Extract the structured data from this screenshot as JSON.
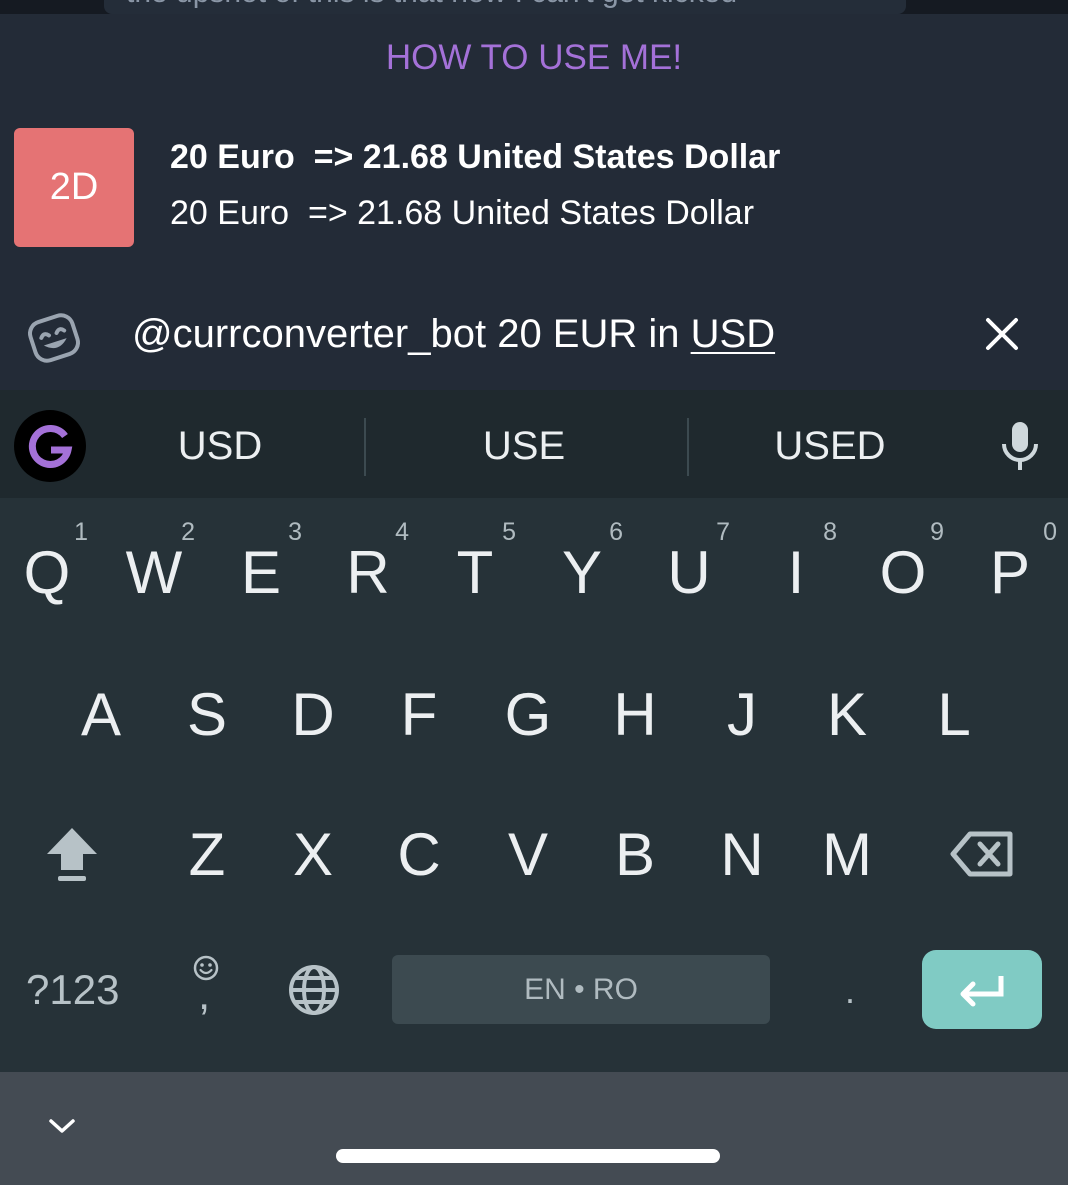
{
  "chat": {
    "previous_message": "the upshot of this is that now I can't get kicked"
  },
  "bot_results": {
    "header": "HOW TO USE ME!",
    "items": [
      {
        "avatar_text": "2D",
        "title": "20 Euro  => 21.68 United States Dollar",
        "description": "20 Euro  => 21.68 United States Dollar"
      }
    ]
  },
  "input": {
    "text_prefix": "@currconverter_bot 20 EUR in ",
    "text_composing": "USD"
  },
  "keyboard": {
    "suggestions": [
      "USD",
      "USE",
      "USED"
    ],
    "row1": [
      {
        "letter": "Q",
        "hint": "1"
      },
      {
        "letter": "W",
        "hint": "2"
      },
      {
        "letter": "E",
        "hint": "3"
      },
      {
        "letter": "R",
        "hint": "4"
      },
      {
        "letter": "T",
        "hint": "5"
      },
      {
        "letter": "Y",
        "hint": "6"
      },
      {
        "letter": "U",
        "hint": "7"
      },
      {
        "letter": "I",
        "hint": "8"
      },
      {
        "letter": "O",
        "hint": "9"
      },
      {
        "letter": "P",
        "hint": "0"
      }
    ],
    "row2": [
      "A",
      "S",
      "D",
      "F",
      "G",
      "H",
      "J",
      "K",
      "L"
    ],
    "row3": [
      "Z",
      "X",
      "C",
      "V",
      "B",
      "N",
      "M"
    ],
    "symbols_label": "?123",
    "comma_label": ",",
    "period_label": ".",
    "space_label": "EN • RO",
    "icons": {
      "logo": "google-g-icon",
      "mic": "microphone-icon",
      "shift": "shift-icon",
      "backspace": "backspace-icon",
      "emoji": "emoji-icon",
      "globe": "globe-icon",
      "enter": "enter-icon"
    }
  },
  "colors": {
    "accent_purple": "#a471d8",
    "avatar_bg": "#e57374",
    "enter_key": "#80cbc4",
    "panel_bg": "#232b37",
    "keyboard_bg": "#263238"
  }
}
